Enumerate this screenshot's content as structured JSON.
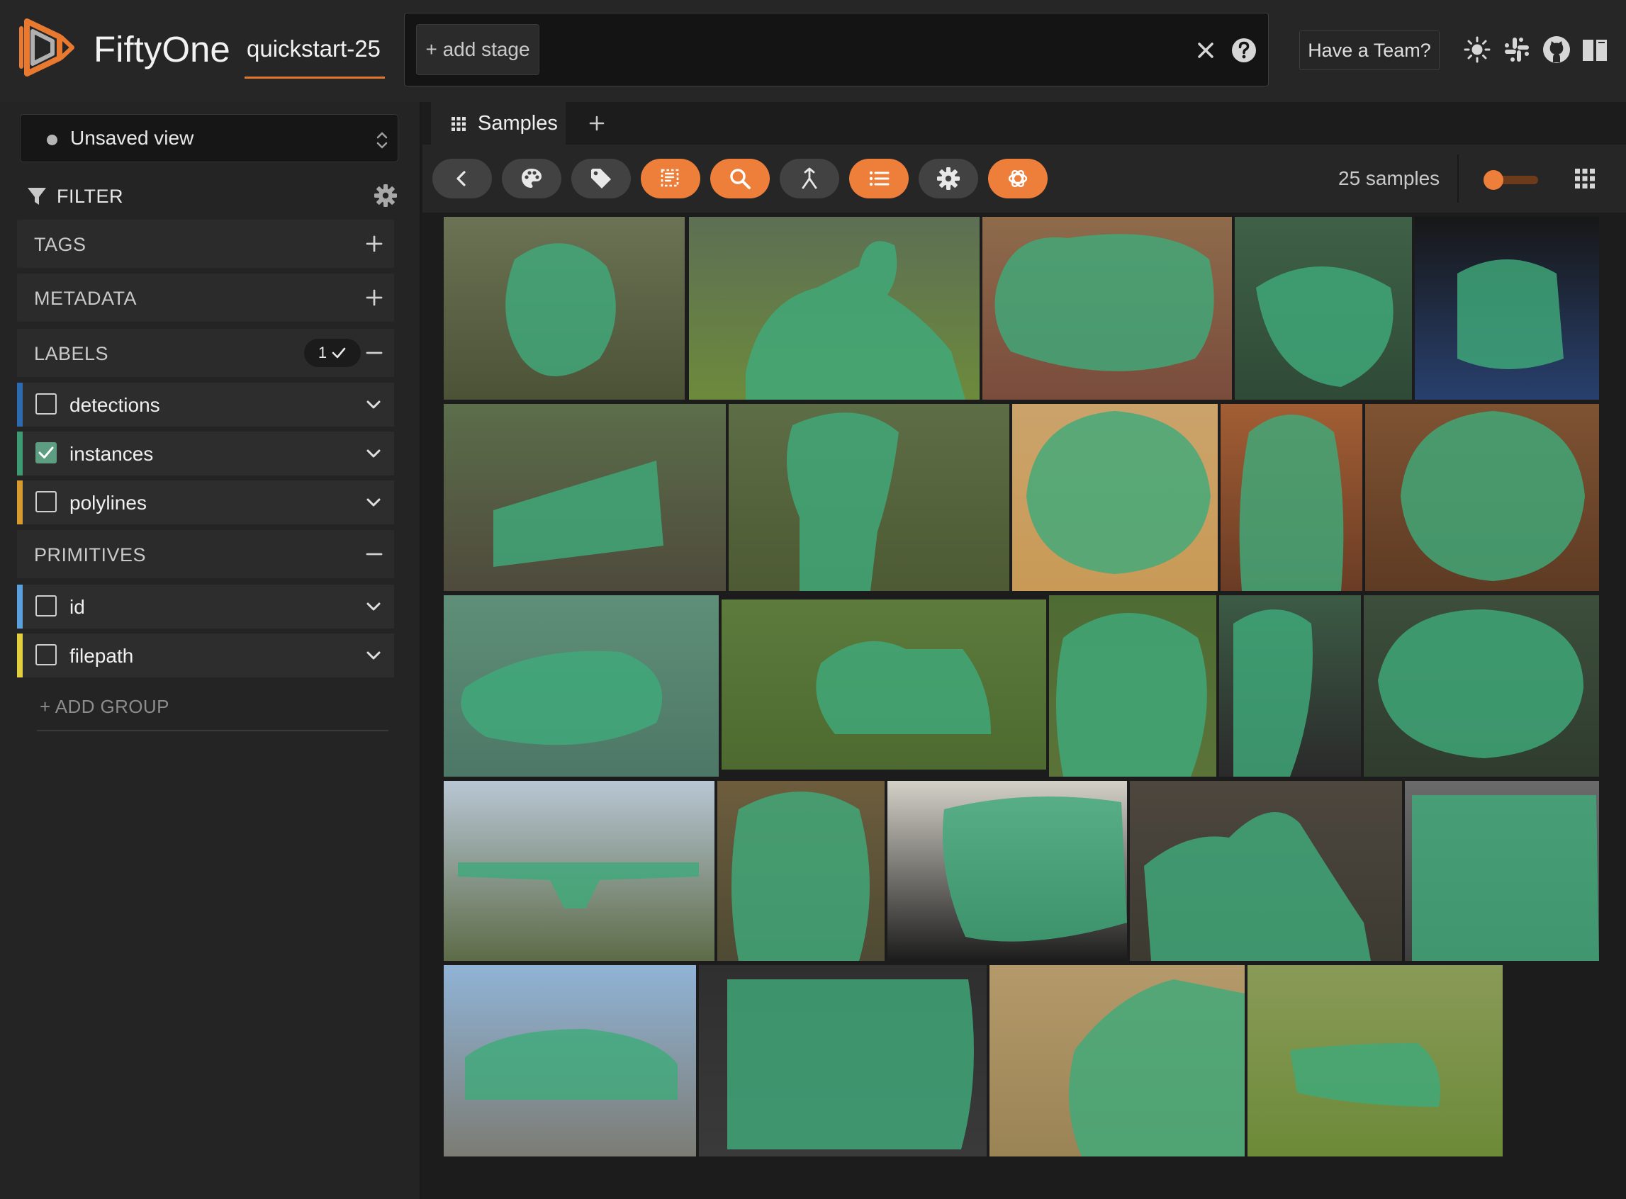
{
  "header": {
    "app_title": "FiftyOne",
    "dataset_name": "quickstart-25",
    "add_stage_label": "+ add stage",
    "team_button_label": "Have a Team?"
  },
  "sidebar": {
    "view_select_label": "Unsaved view",
    "filter_label": "FILTER",
    "groups": {
      "tags": "TAGS",
      "metadata": "METADATA",
      "labels": "LABELS",
      "labels_count": "1",
      "primitives": "PRIMITIVES"
    },
    "label_fields": [
      {
        "label": "detections",
        "checked": false,
        "color": "#2d6bb0"
      },
      {
        "label": "instances",
        "checked": true,
        "color": "#3c9b72"
      },
      {
        "label": "polylines",
        "checked": false,
        "color": "#d79a2e"
      }
    ],
    "primitive_fields": [
      {
        "label": "id",
        "checked": false,
        "color": "#5aa0de"
      },
      {
        "label": "filepath",
        "checked": false,
        "color": "#e2cf3e"
      }
    ],
    "add_group_label": "+ ADD GROUP"
  },
  "main": {
    "tab_label": "Samples",
    "sample_count": "25 samples",
    "toolbar_icons": [
      "back-icon",
      "palette-icon",
      "tag-icon",
      "select-icon",
      "search-icon",
      "merge-icon",
      "list-icon",
      "gear-icon",
      "openai-icon"
    ],
    "active_toolbar_icons": [
      "select-icon",
      "search-icon",
      "list-icon",
      "openai-icon"
    ],
    "thumbnail_size": 0.25
  },
  "colors": {
    "accent": "#ee7f3a",
    "overlay": "#3fa97a",
    "background": "#1c1c1c",
    "panel": "#262626"
  }
}
